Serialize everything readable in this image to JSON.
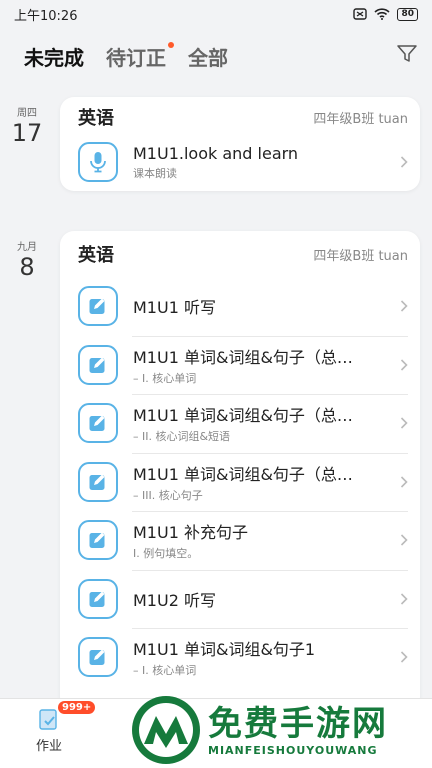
{
  "status": {
    "time": "上午10:26",
    "battery": "80"
  },
  "tabs": [
    {
      "label": "未完成"
    },
    {
      "label": "待订正"
    },
    {
      "label": "全部"
    }
  ],
  "groups": [
    {
      "date": {
        "weekday": "周四",
        "day": "17"
      },
      "subject": "英语",
      "class": "四年级B班 tuan",
      "tasks": [
        {
          "title": "M1U1.look and learn",
          "sub": "课本朗读",
          "icon": "microphone-icon"
        }
      ]
    },
    {
      "date": {
        "weekday": "九月",
        "day": "8"
      },
      "subject": "英语",
      "class": "四年级B班 tuan",
      "tasks": [
        {
          "title": "M1U1 听写",
          "sub": "",
          "icon": "edit-icon"
        },
        {
          "title": "M1U1 单词&词组&句子（总…",
          "sub": "– I. 核心单词",
          "icon": "edit-icon"
        },
        {
          "title": "M1U1 单词&词组&句子（总…",
          "sub": "– II. 核心词组&短语",
          "icon": "edit-icon"
        },
        {
          "title": "M1U1 单词&词组&句子（总…",
          "sub": "– III. 核心句子",
          "icon": "edit-icon"
        },
        {
          "title": "M1U1 补充句子",
          "sub": "I. 例句填空。",
          "icon": "edit-icon"
        },
        {
          "title": "M1U2 听写",
          "sub": "",
          "icon": "edit-icon"
        },
        {
          "title": "M1U1 单词&词组&句子1",
          "sub": "– I. 核心单词",
          "icon": "edit-icon"
        }
      ]
    }
  ],
  "bottom_nav": {
    "homework": "作业",
    "badge": "999+"
  },
  "watermark": {
    "cn": "免费手游网",
    "en": "MIANFEISHOUYOUWANG"
  },
  "colors": {
    "accent": "#59b3e6",
    "badge": "#ff4d2a",
    "watermark": "#167a3c"
  }
}
